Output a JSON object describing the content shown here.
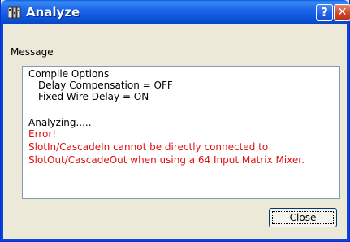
{
  "window": {
    "title": "Analyze",
    "help_glyph": "?",
    "close_glyph": "✕"
  },
  "message_label": "Message",
  "messages": {
    "line1": "Compile Options",
    "line2": "Delay Compensation = OFF",
    "line3": "Fixed Wire Delay = ON",
    "line4": "Analyzing.....",
    "line5": "Error!",
    "line6": "SlotIn/CascadeIn cannot be directly connected to",
    "line7": "SlotOut/CascadeOut when using a 64 Input Matrix Mixer."
  },
  "buttons": {
    "close_label": "Close"
  },
  "colors": {
    "titlebar": "#0a52d6",
    "error_text": "#e01010",
    "dialog_bg": "#ece9d8"
  },
  "icons": {
    "app": "analyze-app-icon",
    "help": "help-icon",
    "close": "close-icon"
  }
}
